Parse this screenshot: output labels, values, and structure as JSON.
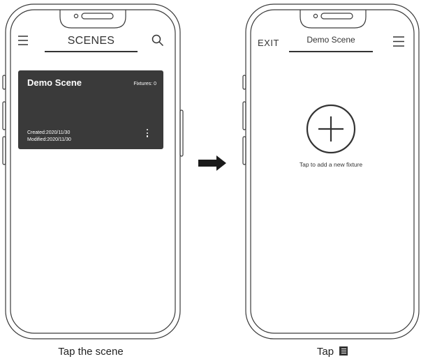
{
  "left_screen": {
    "title": "SCENES",
    "menu_icon": "hamburger-icon",
    "search_icon": "search-icon",
    "scene_card": {
      "name": "Demo Scene",
      "fixtures": "Fixtures: 0",
      "created": "Created:2020/11/30",
      "modified": "Modified:2020/11/30",
      "more_icon": "kebab-menu-icon"
    },
    "caption": "Tap the scene"
  },
  "right_screen": {
    "exit_label": "EXIT",
    "title": "Demo Scene",
    "menu_icon": "hamburger-icon",
    "add_icon": "plus-circle-icon",
    "add_hint": "Tap to add a new fixture",
    "caption": "Tap",
    "caption_icon": "menu-icon"
  },
  "transition_arrow_icon": "right-arrow-icon"
}
